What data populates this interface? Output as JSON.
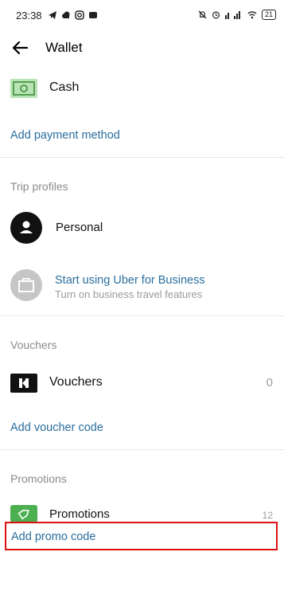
{
  "status_bar": {
    "time": "23:38",
    "battery": "21"
  },
  "header": {
    "title": "Wallet"
  },
  "payment": {
    "cash_label": "Cash",
    "add_payment_label": "Add payment method"
  },
  "trip_profiles": {
    "section_title": "Trip profiles",
    "personal_label": "Personal",
    "business_title": "Start using Uber for Business",
    "business_subtitle": "Turn on business travel features"
  },
  "vouchers": {
    "section_title": "Vouchers",
    "row_label": "Vouchers",
    "count": "0",
    "add_label": "Add voucher code"
  },
  "promotions": {
    "section_title": "Promotions",
    "row_label": "Promotions",
    "count": "12",
    "add_label": "Add promo code"
  },
  "colors": {
    "link": "#2a6e9e",
    "cash_icon_bg": "#b8e3b5",
    "promo_icon_bg": "#4caf50",
    "highlight": "#dd1111"
  }
}
